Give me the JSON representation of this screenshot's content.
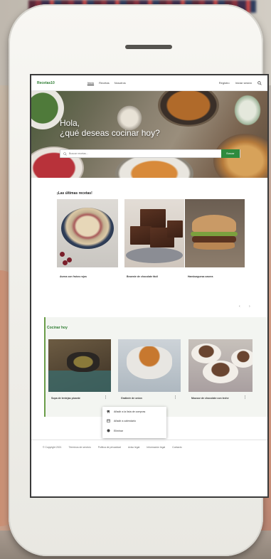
{
  "nav": {
    "brand": "Recetas10",
    "links": [
      "Inicio",
      "Recetas",
      "Nosotros"
    ],
    "right_links": [
      "Registro",
      "Iniciar sesión"
    ],
    "search_icon": "search-icon"
  },
  "hero": {
    "title_line1": "Hola,",
    "title_line2": "¿qué deseas cocinar hoy?",
    "search_placeholder": "Buscar recetas...",
    "search_button": "Buscar"
  },
  "latest": {
    "title": "¡Las últimas recetas!",
    "cards": [
      {
        "label": "Avena con frutos rojos"
      },
      {
        "label": "Brownie de chocolate fácil"
      },
      {
        "label": "Hamburguesa casera"
      }
    ],
    "pager": [
      "‹",
      "›"
    ]
  },
  "cook": {
    "title": "Cocinar hoy",
    "cards": [
      {
        "label": "Sopa de lentejas picante",
        "more": "⋮"
      },
      {
        "label": "Gratinée de onion",
        "more": "⋮"
      },
      {
        "label": "Mousse de chocolate con leche",
        "more": "⋮"
      }
    ]
  },
  "menu": {
    "items": [
      {
        "label": "Añadir a la lista de compras",
        "icon": "cart-icon"
      },
      {
        "label": "Añadir a calendario",
        "icon": "calendar-icon"
      },
      {
        "label": "Eliminar",
        "icon": "circle-icon"
      }
    ]
  },
  "footer": {
    "links": [
      "© Copyright 2021",
      "Términos de servicio",
      "Política de privacidad",
      "Aviso legal",
      "Información legal",
      "Contacto"
    ]
  },
  "colors": {
    "accent": "#2e8b3e",
    "brand": "#2e7d32",
    "section_bg": "#f3f5f1"
  }
}
